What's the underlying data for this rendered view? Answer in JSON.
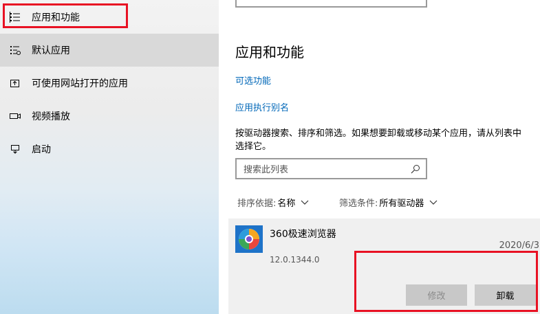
{
  "sidebar": {
    "items": [
      {
        "label": "应用和功能",
        "icon": "list-icon"
      },
      {
        "label": "默认应用",
        "icon": "default-apps-icon"
      },
      {
        "label": "可使用网站打开的应用",
        "icon": "open-external-icon"
      },
      {
        "label": "视频播放",
        "icon": "video-icon"
      },
      {
        "label": "启动",
        "icon": "startup-icon"
      }
    ]
  },
  "main": {
    "title": "应用和功能",
    "links": {
      "optional_features": "可选功能",
      "app_execution_aliases": "应用执行别名"
    },
    "description_line1": "按驱动器搜索、排序和筛选。如果想要卸载或移动某个应用，请从列表中",
    "description_line2": "选择它。",
    "search": {
      "placeholder": "搜索此列表",
      "value": ""
    },
    "sort": {
      "label": "排序依据:",
      "value": "名称"
    },
    "filter": {
      "label": "筛选条件:",
      "value": "所有驱动器"
    },
    "app": {
      "name": "360极速浏览器",
      "date": "2020/6/3",
      "version": "12.0.1344.0",
      "modify_label": "修改",
      "uninstall_label": "卸载"
    }
  },
  "colors": {
    "link": "#0067b8",
    "highlight": "#e81123"
  }
}
